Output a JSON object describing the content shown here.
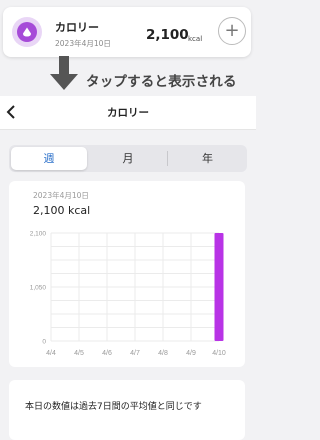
{
  "summary": {
    "title": "カロリー",
    "date": "2023年4月10日",
    "value": "2,100",
    "unit": "kcal",
    "add_label": "+",
    "accent": "#a64bd8"
  },
  "annotation": {
    "caption": "タップすると表示される"
  },
  "nav": {
    "back_icon": "chevron-left-icon",
    "title": "カロリー"
  },
  "segments": {
    "items": [
      "週",
      "月",
      "年"
    ],
    "selected": "週"
  },
  "chart_header": {
    "date": "2023年4月10日",
    "value": "2,100 kcal"
  },
  "chart_data": {
    "type": "bar",
    "categories": [
      "4/4",
      "4/5",
      "4/6",
      "4/7",
      "4/8",
      "4/9",
      "4/10"
    ],
    "values": [
      0,
      0,
      0,
      0,
      0,
      0,
      2100
    ],
    "y_ticks": [
      "0",
      "1,050",
      "2,100"
    ],
    "ylim": [
      0,
      2100
    ],
    "grid": true,
    "bar_color": "#b833e6"
  },
  "note": {
    "text": "本日の数値は過去7日間の平均値と同じです"
  }
}
